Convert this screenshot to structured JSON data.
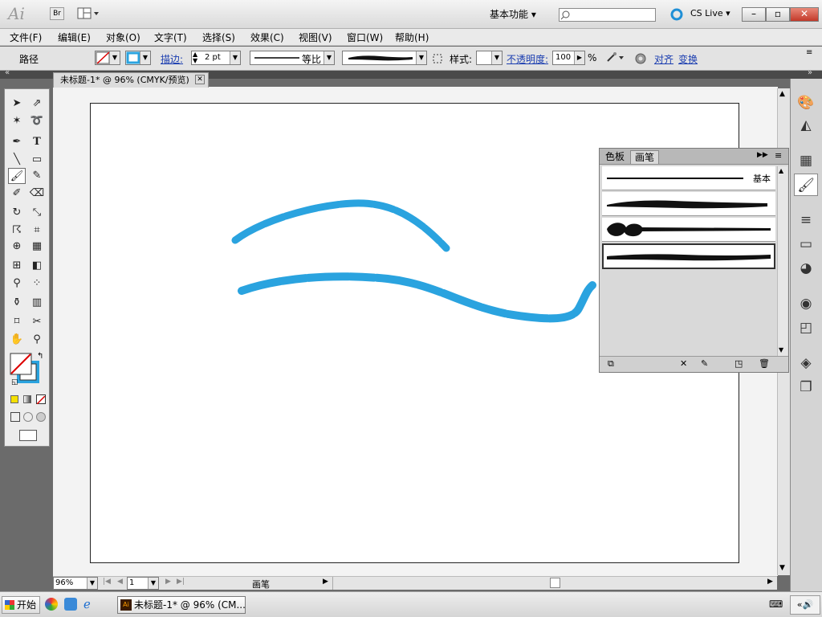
{
  "titlebar": {
    "app_logo": "Ai",
    "bridge_btn": "Br",
    "workspace_label": "基本功能",
    "cslive_label": "CS Live",
    "win_min": "–",
    "win_max": "▫",
    "win_close": "✕"
  },
  "menubar": {
    "items": [
      {
        "label": "文件(F)"
      },
      {
        "label": "编辑(E)"
      },
      {
        "label": "对象(O)"
      },
      {
        "label": "文字(T)"
      },
      {
        "label": "选择(S)"
      },
      {
        "label": "效果(C)"
      },
      {
        "label": "视图(V)"
      },
      {
        "label": "窗口(W)"
      },
      {
        "label": "帮助(H)"
      }
    ]
  },
  "control": {
    "selection_label": "路径",
    "stroke_label": "描边:",
    "stroke_weight": "2 pt",
    "profile_label": "等比",
    "style_label": "样式:",
    "opacity_label": "不透明度:",
    "opacity_value": "100",
    "opacity_unit": "%",
    "align_label": "对齐",
    "transform_label": "变换"
  },
  "document": {
    "tab_title": "未标题-1* @ 96% (CMYK/预览)",
    "zoom_value": "96%",
    "artboard_value": "1",
    "status_label": "画笔"
  },
  "brush_panel": {
    "tab_swatches": "色板",
    "tab_brushes": "画笔",
    "basic_brush_label": "基本"
  },
  "colors": {
    "stroke_blue": "#2aa3df",
    "accent_link": "#1a3db0"
  },
  "taskbar": {
    "start_label": "开始",
    "task_label": "未标题-1* @ 96% (CM..."
  }
}
